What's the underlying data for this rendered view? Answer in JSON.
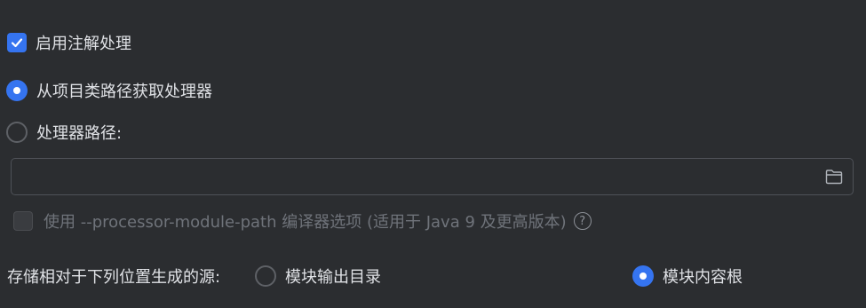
{
  "annotation_processing": {
    "enable_label": "启用注解处理",
    "enabled": true
  },
  "processor_source": {
    "classpath_label": "从项目类路径获取处理器",
    "classpath_selected": true,
    "path_label": "处理器路径:",
    "path_selected": false,
    "path_value": "",
    "folder_icon": "folder-icon"
  },
  "module_path_option": {
    "label": "使用 --processor-module-path 编译器选项 (适用于 Java 9 及更高版本)",
    "checked": false,
    "disabled": true,
    "help_glyph": "?"
  },
  "generated_sources": {
    "label": "存储相对于下列位置生成的源:",
    "options": [
      {
        "label": "模块输出目录",
        "selected": false
      },
      {
        "label": "模块内容根",
        "selected": true
      }
    ]
  },
  "colors": {
    "background": "#2b2d30",
    "accent": "#3574f0",
    "text": "#dfe1e5",
    "disabled_text": "#6f737a"
  }
}
